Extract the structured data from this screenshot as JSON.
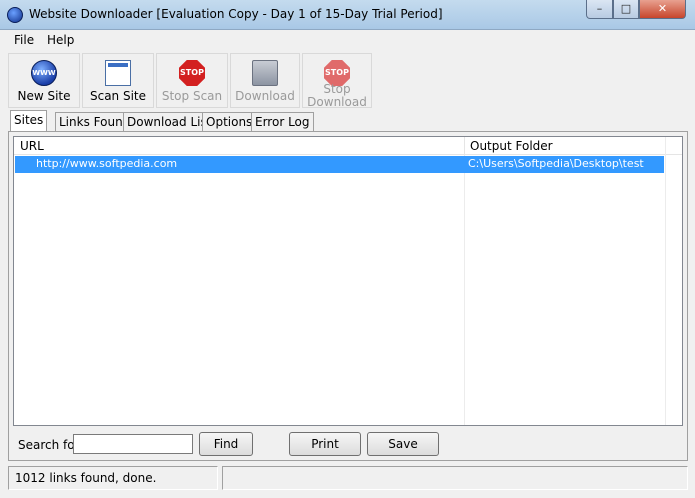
{
  "window": {
    "title": "Website Downloader [Evaluation Copy - Day 1 of 15-Day Trial Period]",
    "minimize_glyph": "–",
    "maximize_glyph": "□",
    "close_glyph": "✕"
  },
  "menu": [
    "File",
    "Help"
  ],
  "toolbar": {
    "new_site": "New Site",
    "scan_site": "Scan Site",
    "stop_scan": "Stop Scan",
    "download": "Download",
    "stop_download_1": "Stop",
    "stop_download_2": "Download",
    "stop_icon_text": "STOP",
    "globe_icon_text": "WWW"
  },
  "tabs": [
    "Sites",
    "Links Found",
    "Download List",
    "Options",
    "Error Log"
  ],
  "table": {
    "columns": [
      "URL",
      "Output Folder"
    ],
    "rows": [
      {
        "url": "http://www.softpedia.com",
        "folder": "C:\\Users\\Softpedia\\Desktop\\test"
      }
    ]
  },
  "search": {
    "label": "Search for",
    "value": "",
    "find": "Find",
    "print": "Print",
    "save": "Save"
  },
  "status": {
    "message": "1012 links found, done."
  }
}
